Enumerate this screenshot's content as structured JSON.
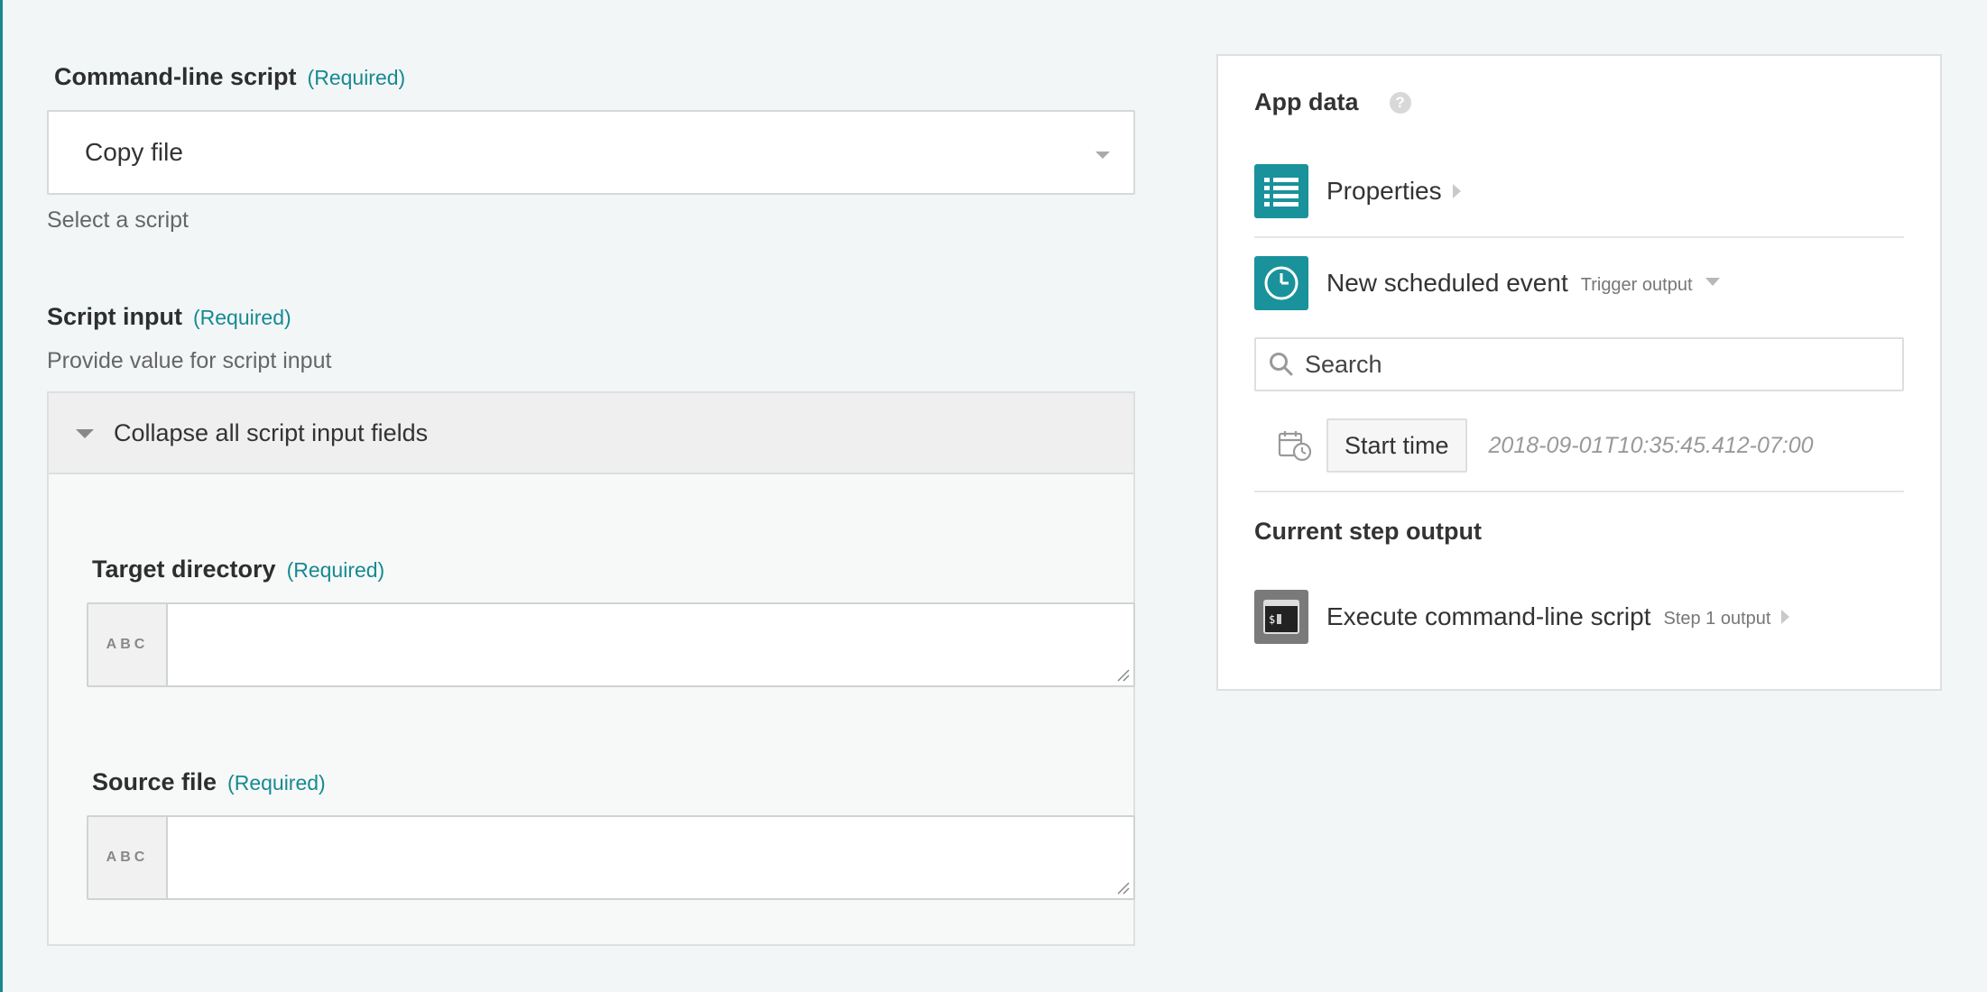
{
  "form": {
    "command_line_script": {
      "label": "Command-line script",
      "required": "(Required)",
      "selected": "Copy file",
      "help": "Select a script"
    },
    "script_input": {
      "label": "Script input",
      "required": "(Required)",
      "help": "Provide value for script input",
      "collapse_label": "Collapse all script input fields",
      "fields": [
        {
          "label": "Target directory",
          "required": "(Required)",
          "type_badge": "ABC",
          "value": ""
        },
        {
          "label": "Source file",
          "required": "(Required)",
          "type_badge": "ABC",
          "value": ""
        }
      ]
    }
  },
  "app_data": {
    "title": "App data",
    "help_icon": "?",
    "properties_label": "Properties",
    "trigger": {
      "label": "New scheduled event",
      "sub": "Trigger output"
    },
    "search_placeholder": "Search",
    "start_time": {
      "label": "Start time",
      "value": "2018-09-01T10:35:45.412-07:00"
    },
    "current_step_title": "Current step output",
    "step_output": {
      "label": "Execute command-line script",
      "sub": "Step 1 output",
      "terminal_prompt": "$"
    }
  },
  "colors": {
    "accent": "#19929b",
    "required": "#158a92",
    "background": "#f3f6f7"
  },
  "icons": [
    "list-icon",
    "clock-icon",
    "search-icon",
    "calendar-clock-icon",
    "terminal-icon",
    "help-icon",
    "chevron-down-icon",
    "chevron-right-icon"
  ]
}
